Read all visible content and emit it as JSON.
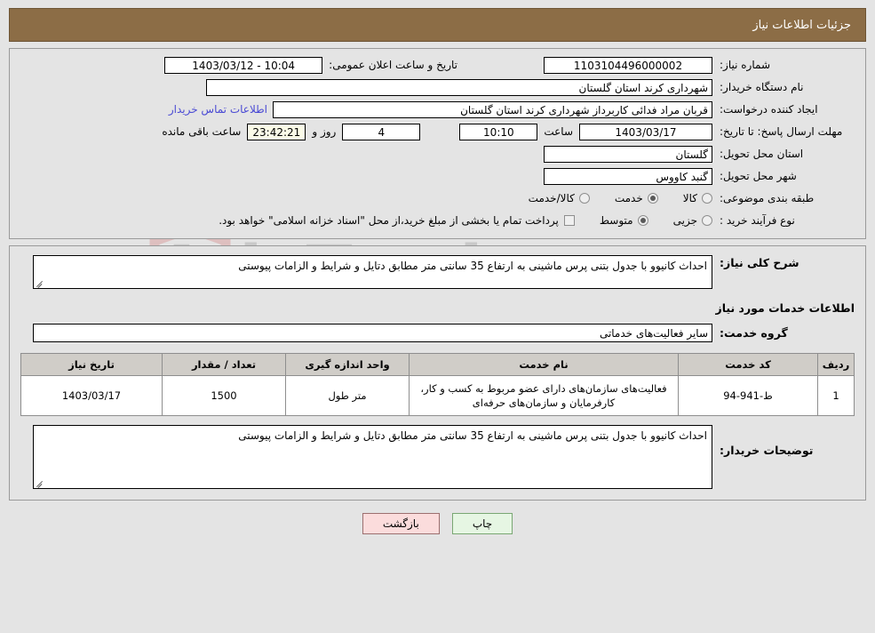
{
  "header": {
    "title": "جزئیات اطلاعات نیاز",
    "bg_color": "#8c6d46"
  },
  "watermark": {
    "text": "AriaTender.net",
    "shield_color": "#d9a0a0",
    "text_color": "#787878"
  },
  "summary": {
    "need_number_label": "شماره نیاز:",
    "need_number_value": "1103104496000002",
    "public_announce_label": "تاریخ و ساعت اعلان عمومی:",
    "public_announce_value": "10:04 - 1403/03/12",
    "buyer_org_label": "نام دستگاه خریدار:",
    "buyer_org_value": "شهرداری کرند استان گلستان",
    "requester_label": "ایجاد کننده درخواست:",
    "requester_value": "قربان مراد فدائی کاربرداز شهرداری کرند استان گلستان",
    "contact_link": "اطلاعات تماس خریدار",
    "deadline_label": "مهلت ارسال پاسخ: تا تاریخ:",
    "deadline_date": "1403/03/17",
    "deadline_hour_label": "ساعت",
    "deadline_hour": "10:10",
    "days_value": "4",
    "days_label": "روز و",
    "countdown_value": "23:42:21",
    "countdown_label": "ساعت باقی مانده",
    "province_label": "استان محل تحویل:",
    "province_value": "گلستان",
    "city_label": "شهر محل تحویل:",
    "city_value": "گنبد کاووس",
    "category_label": "طبقه بندی موضوعی:",
    "category_options": [
      {
        "label": "کالا",
        "checked": false
      },
      {
        "label": "خدمت",
        "checked": true
      },
      {
        "label": "کالا/خدمت",
        "checked": false
      }
    ],
    "purchase_type_label": "نوع فرآیند خرید :",
    "purchase_type_options": [
      {
        "label": "جزیی",
        "checked": false
      },
      {
        "label": "متوسط",
        "checked": true
      }
    ],
    "treasury_checkbox_label": "پرداخت تمام یا بخشی از مبلغ خرید،از محل \"اسناد خزانه اسلامی\" خواهد بود.",
    "treasury_checked": false
  },
  "description": {
    "need_summary_label": "شرح کلی نیاز:",
    "need_summary_value": "احداث کانیوو با جدول بتنی پرس ماشینی به ارتفاع 35 سانتی متر مطابق دتایل و شرایط و الزامات پیوستی",
    "services_section_title": "اطلاعات خدمات مورد نیاز",
    "service_group_label": "گروه خدمت:",
    "service_group_value": "سایر فعالیت‌های خدماتی"
  },
  "table": {
    "columns": [
      "ردیف",
      "کد خدمت",
      "نام خدمت",
      "واحد اندازه گیری",
      "تعداد / مقدار",
      "تاریخ نیاز"
    ],
    "rows": [
      {
        "row": "1",
        "code": "ط-941-94",
        "name": "فعالیت‌های سازمان‌های دارای عضو مربوط به کسب و کار، کارفرمایان و سازمان‌های حرفه‌ای",
        "unit": "متر طول",
        "quantity": "1500",
        "date": "1403/03/17"
      }
    ]
  },
  "buyer_notes": {
    "label": "توضیحات خریدار:",
    "value": "احداث کانیوو با جدول بتنی پرس ماشینی به ارتفاع 35 سانتی متر مطابق دتایل و شرایط و الزامات پیوستی"
  },
  "buttons": {
    "print": "چاپ",
    "back": "بازگشت"
  }
}
